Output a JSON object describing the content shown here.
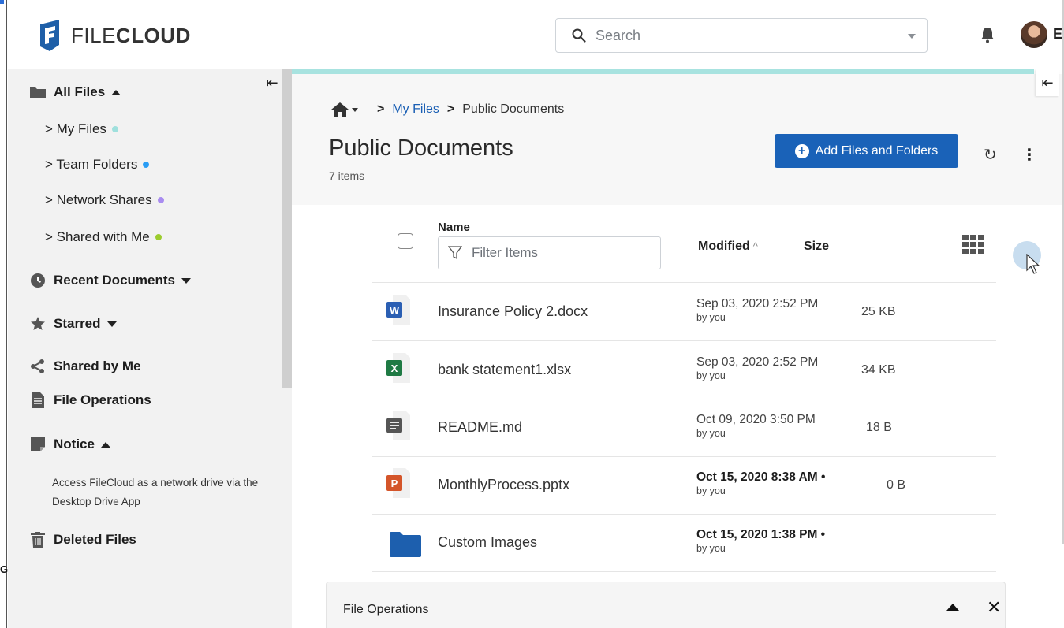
{
  "app": {
    "logo_text_thin": "FILE",
    "logo_text_bold": "CLOUD",
    "search_placeholder": "Search",
    "user_initial": "E"
  },
  "screen_edge": {
    "left_fragment": "Gr"
  },
  "sidebar": {
    "all_files": "All Files",
    "sub_items": [
      {
        "label": "> My Files",
        "dot_color": "#9fe0dd"
      },
      {
        "label": "> Team Folders",
        "dot_color": "#2a9df4"
      },
      {
        "label": "> Network Shares",
        "dot_color": "#a98cf0"
      },
      {
        "label": "> Shared with Me",
        "dot_color": "#9ccc2e"
      }
    ],
    "recent_documents": "Recent Documents",
    "starred": "Starred",
    "shared_by_me": "Shared by Me",
    "file_operations": "File Operations",
    "notice": "Notice",
    "notice_text": "Access FileCloud as a network drive via the Desktop Drive App",
    "deleted_files": "Deleted Files"
  },
  "main": {
    "breadcrumb": {
      "my_files": "My Files",
      "current": "Public Documents",
      "separator": ">"
    },
    "title": "Public Documents",
    "item_count": "7 items",
    "add_button": "Add Files and Folders",
    "table": {
      "name_header": "Name",
      "filter_placeholder": "Filter Items",
      "modified_header": "Modified",
      "size_header": "Size"
    },
    "files": [
      {
        "name": "Insurance Policy 2.docx",
        "type": "word",
        "icon_letter": "W",
        "modified": "Sep 03, 2020 2:52 PM",
        "by": "by you",
        "size": "25 KB",
        "bold": false
      },
      {
        "name": "bank statement1.xlsx",
        "type": "excel",
        "icon_letter": "X",
        "modified": "Sep 03, 2020 2:52 PM",
        "by": "by you",
        "size": "34 KB",
        "bold": false
      },
      {
        "name": "README.md",
        "type": "text",
        "icon_letter": "",
        "modified": "Oct 09, 2020 3:50 PM",
        "by": "by you",
        "size": "18 B",
        "bold": false
      },
      {
        "name": "MonthlyProcess.pptx",
        "type": "powerpoint",
        "icon_letter": "P",
        "modified": "Oct 15, 2020 8:38 AM •",
        "by": "by you",
        "size": "0 B",
        "bold": true
      },
      {
        "name": "Custom Images",
        "type": "folder",
        "icon_letter": "",
        "modified": "Oct 15, 2020 1:38 PM •",
        "by": "by you",
        "size": "",
        "bold": true
      }
    ],
    "file_operations_bar": "File Operations"
  },
  "colors": {
    "primary": "#1a62b8",
    "accent_line": "#a8e3e0",
    "word": "#2b5fb3",
    "excel": "#1f7a44",
    "powerpoint": "#d4552a",
    "folder": "#1d5fae"
  }
}
